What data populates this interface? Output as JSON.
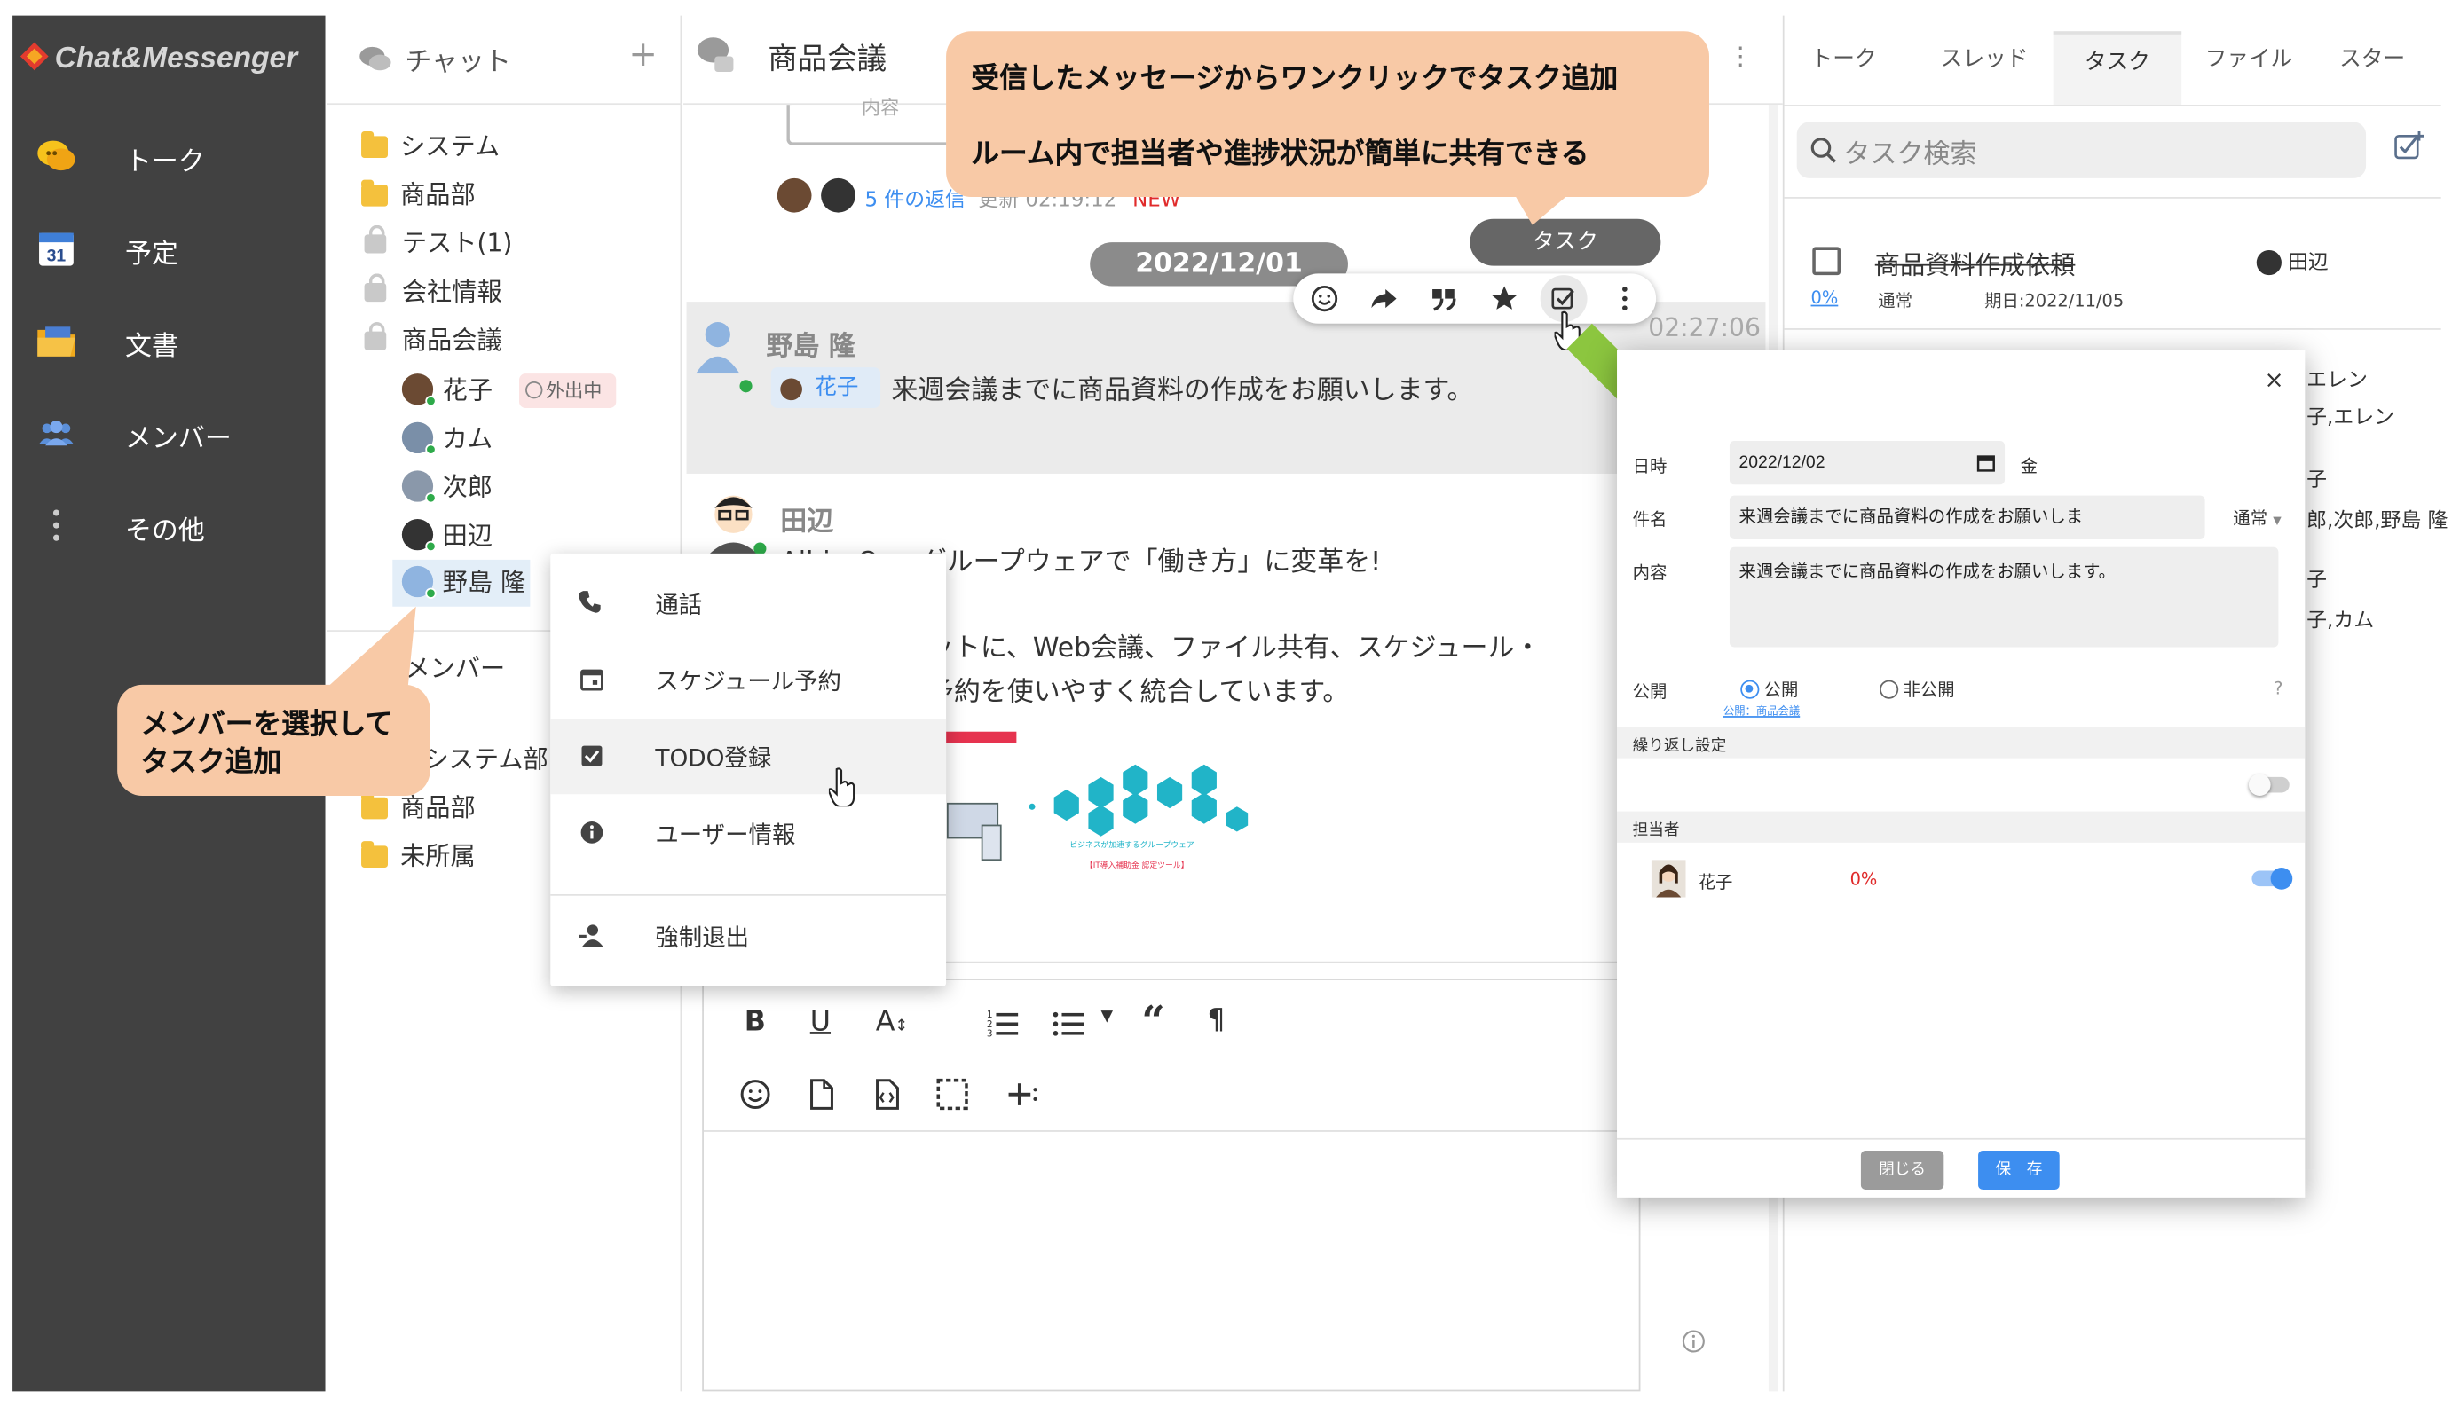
{
  "sidebar": {
    "logo": "Chat&Messenger",
    "items": [
      {
        "label": "トーク",
        "icon": "talk-icon"
      },
      {
        "label": "予定",
        "icon": "calendar-icon",
        "badge": "31"
      },
      {
        "label": "文書",
        "icon": "folder-doc-icon"
      },
      {
        "label": "メンバー",
        "icon": "members-icon"
      },
      {
        "label": "その他",
        "icon": "more-vertical-icon"
      }
    ]
  },
  "chatlist": {
    "title": "チャット",
    "add": "+",
    "folders": [
      "システム",
      "商品部"
    ],
    "locked_rooms": [
      "テスト(1)",
      "会社情報",
      "商品会議"
    ],
    "members": [
      {
        "name": "花子",
        "status": "外出中"
      },
      {
        "name": "カム"
      },
      {
        "name": "次郎"
      },
      {
        "name": "田辺"
      },
      {
        "name": "野島 隆"
      }
    ],
    "member_section": "メンバー",
    "member_folders": [
      "システム部",
      "商品部",
      "未所属"
    ]
  },
  "room": {
    "title": "商品会議",
    "replies": "5 件の返信",
    "updated": "更新 02:19:12",
    "new_badge": "NEW",
    "date_divider": "2022/12/01",
    "quote_peek": "内容",
    "task_tooltip": "タスク",
    "time": "02:27:06",
    "messages": [
      {
        "name": "野島 隆",
        "mention": "花子",
        "text": "来週会議までに商品資料の作成をお願いします。"
      },
      {
        "name": "田辺",
        "lines": [
          "All-in-One グループウェアで「働き方」に変革を!",
          "ットに、Web会議、ファイル共有、スケジュール・",
          "予約を使いやすく統合しています。"
        ]
      }
    ],
    "image_caption_1": "ビジネスが加速するグループウェア",
    "image_caption_2": "【IT導入補助金 認定ツール】"
  },
  "context_menu": {
    "items": [
      {
        "label": "通話",
        "icon": "phone-icon"
      },
      {
        "label": "スケジュール予約",
        "icon": "calendar-small-icon"
      },
      {
        "label": "TODO登録",
        "icon": "checkbox-icon"
      },
      {
        "label": "ユーザー情報",
        "icon": "info-icon"
      },
      {
        "label": "強制退出",
        "icon": "remove-user-icon"
      }
    ]
  },
  "callouts": {
    "top_line1": "受信したメッセージからワンクリックでタスク追加",
    "top_line2": "ルーム内で担当者や進捗状況が簡単に共有できる",
    "left_line1": "メンバーを選択して",
    "left_line2": "タスク追加"
  },
  "right_panel": {
    "tabs": [
      "トーク",
      "スレッド",
      "タスク",
      "ファイル",
      "スター"
    ],
    "active_tab": "タスク",
    "search_placeholder": "タスク検索",
    "tasks": [
      {
        "title": "商品資料作成依頼",
        "assignee": "田辺",
        "progress": "0%",
        "priority": "通常",
        "due": "期日:2022/11/05"
      }
    ],
    "peek_lines": [
      "エレン",
      "子,エレン",
      "子",
      "郎,次郎,野島 隆",
      "子",
      "子,カム"
    ]
  },
  "dialog": {
    "close": "×",
    "date_label": "日時",
    "date_value": "2022/12/02",
    "weekday": "金",
    "subject_label": "件名",
    "subject_value": "来週会議までに商品資料の作成をお願いしま",
    "priority": "通常",
    "content_label": "内容",
    "content_value": "来週会議までに商品資料の作成をお願いします。",
    "visibility_label": "公開",
    "public": "公開",
    "private": "非公開",
    "public_scope": "公開：商品会議",
    "help": "?",
    "repeat_label": "繰り返し設定",
    "assignee_label": "担当者",
    "assignee_name": "花子",
    "assignee_progress": "0%",
    "close_button": "閉じる",
    "save_button": "保　存"
  },
  "colors": {
    "sidebar_bg": "#414141",
    "accent_blue": "#3d8ef0",
    "callout": "#f8c9a6",
    "arrow_green": "#8cc63f",
    "online": "#2eaa4a",
    "progress_red": "#e02b2b"
  }
}
